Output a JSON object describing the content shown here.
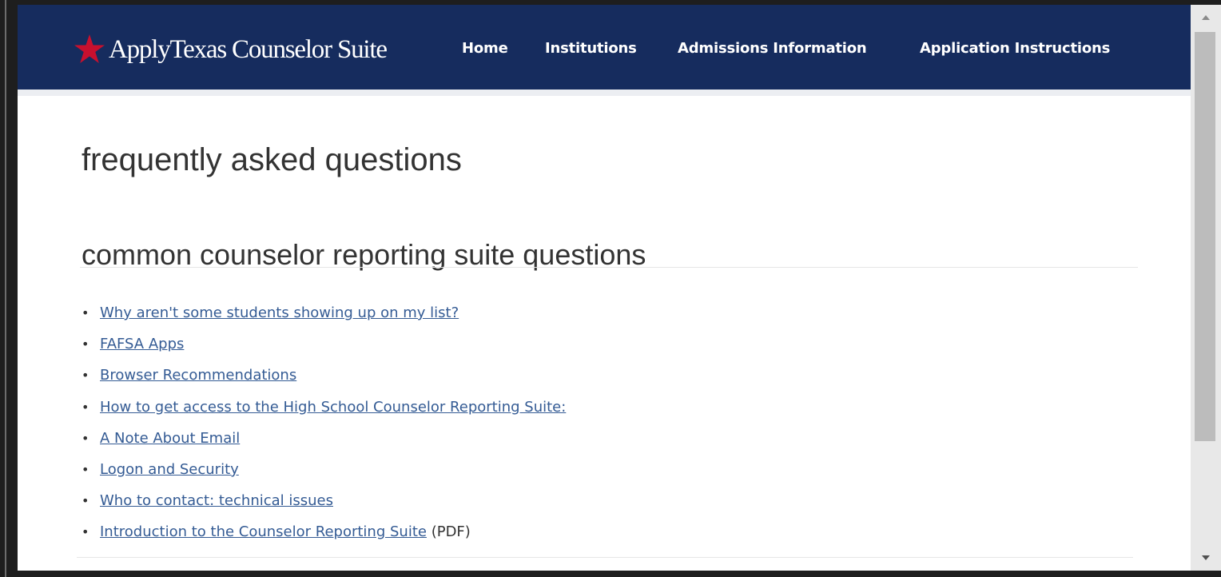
{
  "navbar": {
    "brand_label": "ApplyTexas Counselor Suite",
    "links": [
      {
        "label": "Home"
      },
      {
        "label": "Institutions"
      },
      {
        "label": "Admissions Information"
      },
      {
        "label": "Application Instructions"
      }
    ]
  },
  "main": {
    "page_title": "frequently asked questions",
    "section_title": "common counselor reporting suite questions",
    "faq_items": [
      {
        "label": "Why aren't some students showing up on my list?",
        "suffix": ""
      },
      {
        "label": "FAFSA Apps",
        "suffix": ""
      },
      {
        "label": "Browser Recommendations",
        "suffix": ""
      },
      {
        "label": "How to get access to the High School Counselor Reporting Suite:",
        "suffix": ""
      },
      {
        "label": "A Note About Email",
        "suffix": ""
      },
      {
        "label": "Logon and Security",
        "suffix": ""
      },
      {
        "label": "Who to contact: technical issues",
        "suffix": ""
      },
      {
        "label": "Introduction to the Counselor Reporting Suite",
        "suffix": " (PDF)"
      }
    ]
  },
  "icons": {
    "brand": "star-icon",
    "scroll_up": "triangle-up-icon",
    "scroll_down": "triangle-down-icon"
  },
  "colors": {
    "navbar": "#162c5e",
    "star": "#c8102e",
    "link": "#345b94",
    "text": "#333333"
  }
}
